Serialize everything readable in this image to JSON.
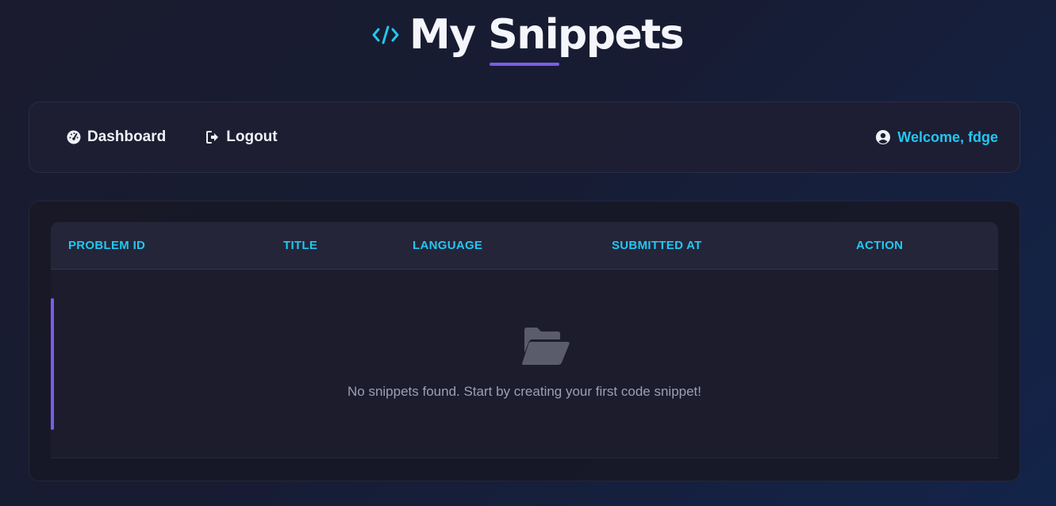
{
  "header": {
    "title": "My Snippets",
    "icon": "code-icon",
    "accent_color": "#22c7f0",
    "underline_color": "#7b5ce8"
  },
  "nav": {
    "links": [
      {
        "label": "Dashboard",
        "icon": "dashboard-gauge-icon"
      },
      {
        "label": "Logout",
        "icon": "logout-icon"
      }
    ],
    "welcome": {
      "label": "Welcome, fdge",
      "icon": "user-circle-icon"
    }
  },
  "table": {
    "columns": [
      "PROBLEM ID",
      "TITLE",
      "LANGUAGE",
      "SUBMITTED AT",
      "ACTION"
    ],
    "rows": [],
    "empty_state": {
      "icon": "folder-open-icon",
      "message": "No snippets found. Start by creating your first code snippet!"
    }
  }
}
